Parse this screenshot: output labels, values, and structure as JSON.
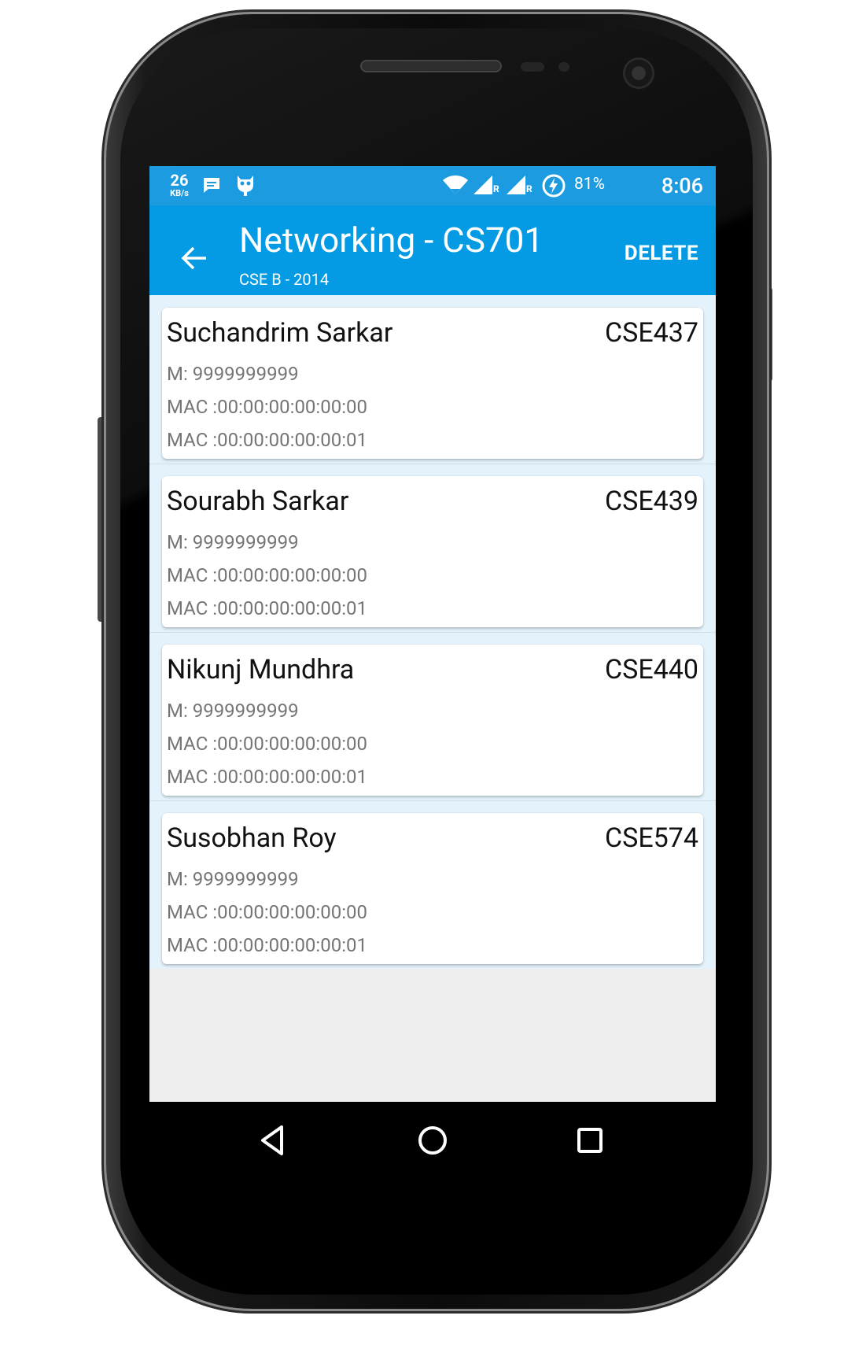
{
  "status_bar": {
    "net_speed_value": "26",
    "net_speed_unit": "KB/s",
    "battery_percent": "81%",
    "time": "8:06",
    "roaming_marker_1": "R",
    "roaming_marker_2": "R",
    "icons": [
      "message-icon",
      "cyanogen-bot-icon",
      "wifi-icon",
      "signal-icon",
      "signal-icon",
      "battery-charging-icon"
    ]
  },
  "app_bar": {
    "title": "Networking - CS701",
    "subtitle": "CSE B - 2014",
    "action_label": "DELETE",
    "color": "#049be4"
  },
  "students": [
    {
      "name": "Suchandrim Sarkar",
      "roll": "CSE437",
      "mobile": "M: 9999999999",
      "mac1": "MAC :00:00:00:00:00:00",
      "mac2": "MAC :00:00:00:00:00:01"
    },
    {
      "name": "Sourabh Sarkar",
      "roll": "CSE439",
      "mobile": "M: 9999999999",
      "mac1": "MAC :00:00:00:00:00:00",
      "mac2": "MAC :00:00:00:00:00:01"
    },
    {
      "name": "Nikunj Mundhra",
      "roll": "CSE440",
      "mobile": "M: 9999999999",
      "mac1": "MAC :00:00:00:00:00:00",
      "mac2": "MAC :00:00:00:00:00:01"
    },
    {
      "name": "Susobhan Roy",
      "roll": "CSE574",
      "mobile": "M: 9999999999",
      "mac1": "MAC :00:00:00:00:00:00",
      "mac2": "MAC :00:00:00:00:00:01"
    }
  ],
  "nav_bar": {
    "icons": [
      "back-triangle-icon",
      "home-circle-icon",
      "recents-square-icon"
    ]
  }
}
